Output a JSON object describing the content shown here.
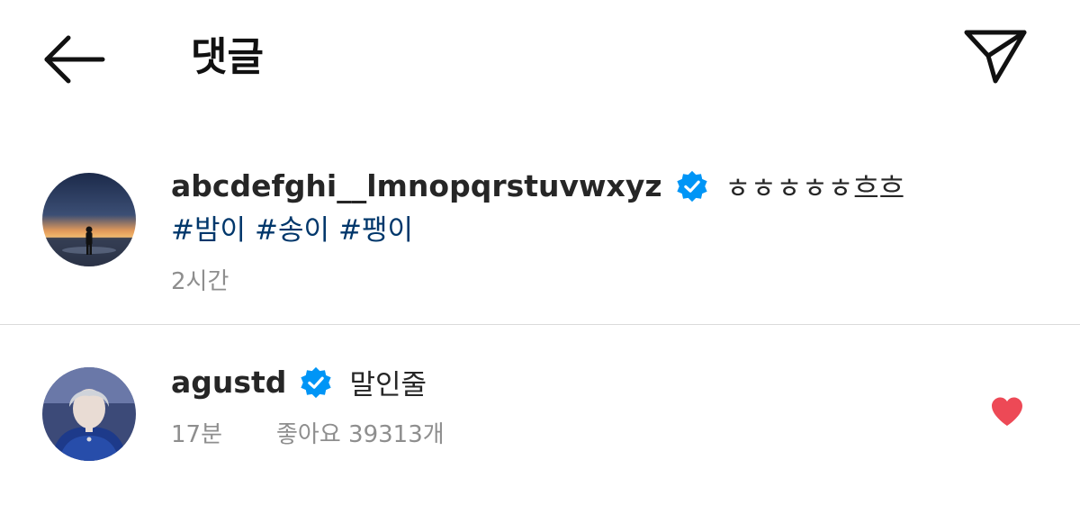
{
  "header": {
    "title": "댓글",
    "back_icon": "arrow-left-icon",
    "share_icon": "paper-plane-icon"
  },
  "caption": {
    "username": "abcdefghi__lmnopqrstuvwxyz",
    "verified": true,
    "text": "ㅎㅎㅎㅎㅎ흐흐",
    "hashtags": [
      "#밤이",
      "#송이",
      "#팽이"
    ],
    "time": "2시간"
  },
  "comments": [
    {
      "username": "agustd",
      "verified": true,
      "text": "말인줄",
      "time": "17분",
      "likes": "좋아요 39313개",
      "liked": true
    }
  ],
  "colors": {
    "verified_badge": "#0095f6",
    "hashtag": "#00376b",
    "heart": "#ed4956",
    "meta_text": "#8e8e8e"
  }
}
